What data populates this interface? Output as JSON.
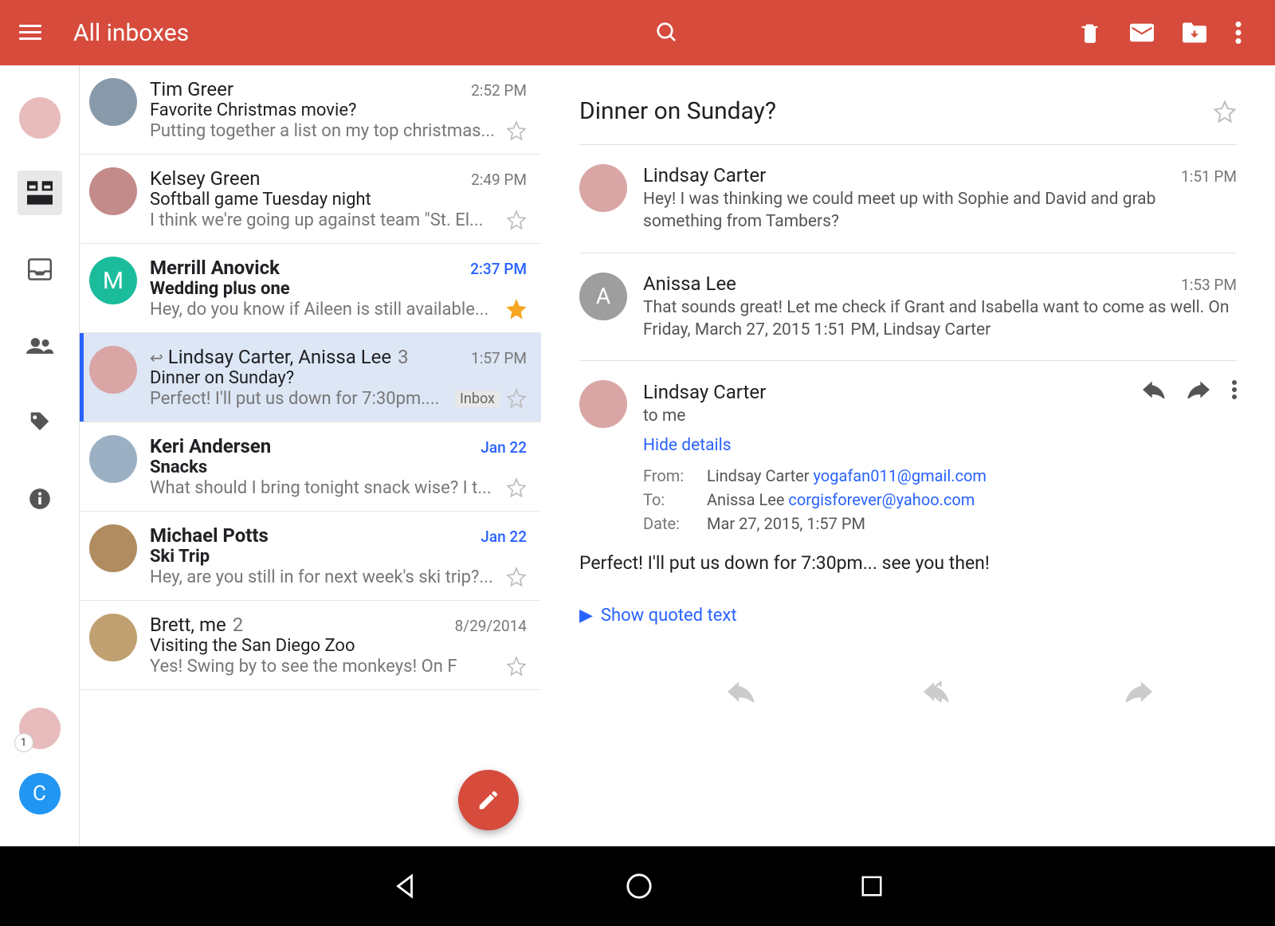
{
  "header": {
    "title": "All inboxes"
  },
  "sidebar": {
    "badge": "1"
  },
  "list": [
    {
      "sender": "Tim Greer",
      "time": "2:52 PM",
      "subject": "Favorite Christmas movie?",
      "snippet": "Putting together a list on my top christmas...",
      "unread": false,
      "starred": false,
      "avatar_color": "#8899aa"
    },
    {
      "sender": "Kelsey Green",
      "time": "2:49 PM",
      "subject": "Softball game Tuesday night",
      "snippet": "I think we're going up against team \"St. El...",
      "unread": false,
      "starred": false,
      "avatar_color": "#c48b8b"
    },
    {
      "sender": "Merrill Anovick",
      "time": "2:37 PM",
      "subject": "Wedding plus one",
      "snippet": "Hey, do you know if Aileen is still available...",
      "unread": true,
      "starred": true,
      "avatar_color": "#1abc9c",
      "avatar_letter": "M"
    },
    {
      "sender": "Lindsay Carter, Anissa Lee",
      "count": "3",
      "time": "1:57 PM",
      "subject": "Dinner on Sunday?",
      "snippet": "Perfect! I'll put us down for 7:30pm....",
      "unread": false,
      "starred": false,
      "selected": true,
      "replied": true,
      "label": "Inbox",
      "avatar_color": "#d9a5a5"
    },
    {
      "sender": "Keri Andersen",
      "time": "Jan 22",
      "subject": "Snacks",
      "snippet": "What should I bring tonight snack wise? I t...",
      "unread": true,
      "starred": false,
      "avatar_color": "#9cb0c4"
    },
    {
      "sender": "Michael Potts",
      "time": "Jan 22",
      "subject": "Ski Trip",
      "snippet": "Hey, are you still in for next week's ski trip?...",
      "unread": true,
      "starred": false,
      "avatar_color": "#b08c60"
    },
    {
      "sender": "Brett, me",
      "count": "2",
      "time": "8/29/2014",
      "subject": "Visiting the San Diego Zoo",
      "snippet": "Yes! Swing by to see the monkeys! On F",
      "unread": false,
      "starred": false,
      "avatar_color": "#c0a070"
    }
  ],
  "thread": {
    "title": "Dinner on Sunday?",
    "messages": [
      {
        "sender": "Lindsay Carter",
        "time": "1:51 PM",
        "snippet": "Hey! I was thinking we could meet up with Sophie and David and grab something from Tambers?",
        "avatar_color": "#d9a5a5"
      },
      {
        "sender": "Anissa Lee",
        "time": "1:53 PM",
        "snippet": "That sounds great! Let me check if Grant and Isabella want to come as well. On Friday, March 27, 2015 1:51 PM, Lindsay Carter",
        "avatar_color": "#9e9e9e",
        "avatar_letter": "A"
      }
    ],
    "expanded": {
      "sender": "Lindsay Carter",
      "to_line": "to me",
      "hide_details": "Hide details",
      "from_label": "From:",
      "from_name": "Lindsay Carter",
      "from_email": "yogafan011@gmail.com",
      "to_label": "To:",
      "to_name": "Anissa Lee",
      "to_email": "corgisforever@yahoo.com",
      "date_label": "Date:",
      "date": "Mar 27, 2015, 1:57 PM",
      "body": "Perfect! I'll put us down for 7:30pm... see you then!",
      "show_quoted": "Show quoted text",
      "avatar_color": "#d9a5a5"
    }
  }
}
